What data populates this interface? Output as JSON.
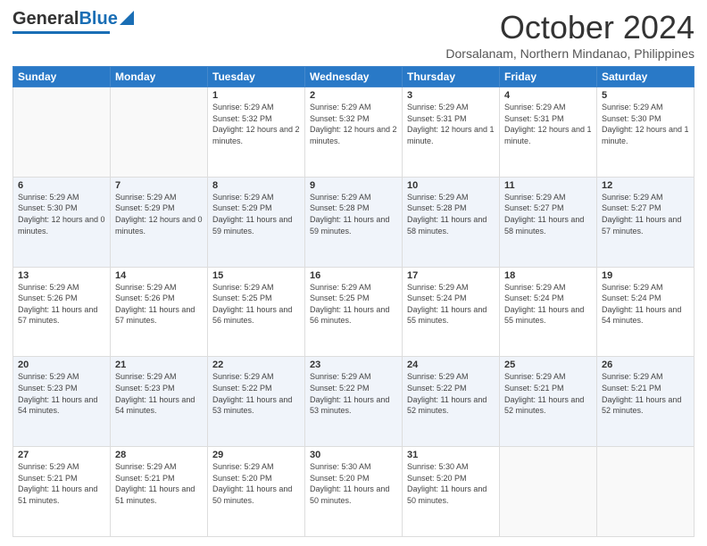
{
  "header": {
    "logo_text_general": "General",
    "logo_text_blue": "Blue",
    "month_title": "October 2024",
    "location": "Dorsalanam, Northern Mindanao, Philippines"
  },
  "days_of_week": [
    "Sunday",
    "Monday",
    "Tuesday",
    "Wednesday",
    "Thursday",
    "Friday",
    "Saturday"
  ],
  "weeks": [
    [
      {
        "day": "",
        "info": ""
      },
      {
        "day": "",
        "info": ""
      },
      {
        "day": "1",
        "info": "Sunrise: 5:29 AM\nSunset: 5:32 PM\nDaylight: 12 hours and 2 minutes."
      },
      {
        "day": "2",
        "info": "Sunrise: 5:29 AM\nSunset: 5:32 PM\nDaylight: 12 hours and 2 minutes."
      },
      {
        "day": "3",
        "info": "Sunrise: 5:29 AM\nSunset: 5:31 PM\nDaylight: 12 hours and 1 minute."
      },
      {
        "day": "4",
        "info": "Sunrise: 5:29 AM\nSunset: 5:31 PM\nDaylight: 12 hours and 1 minute."
      },
      {
        "day": "5",
        "info": "Sunrise: 5:29 AM\nSunset: 5:30 PM\nDaylight: 12 hours and 1 minute."
      }
    ],
    [
      {
        "day": "6",
        "info": "Sunrise: 5:29 AM\nSunset: 5:30 PM\nDaylight: 12 hours and 0 minutes."
      },
      {
        "day": "7",
        "info": "Sunrise: 5:29 AM\nSunset: 5:29 PM\nDaylight: 12 hours and 0 minutes."
      },
      {
        "day": "8",
        "info": "Sunrise: 5:29 AM\nSunset: 5:29 PM\nDaylight: 11 hours and 59 minutes."
      },
      {
        "day": "9",
        "info": "Sunrise: 5:29 AM\nSunset: 5:28 PM\nDaylight: 11 hours and 59 minutes."
      },
      {
        "day": "10",
        "info": "Sunrise: 5:29 AM\nSunset: 5:28 PM\nDaylight: 11 hours and 58 minutes."
      },
      {
        "day": "11",
        "info": "Sunrise: 5:29 AM\nSunset: 5:27 PM\nDaylight: 11 hours and 58 minutes."
      },
      {
        "day": "12",
        "info": "Sunrise: 5:29 AM\nSunset: 5:27 PM\nDaylight: 11 hours and 57 minutes."
      }
    ],
    [
      {
        "day": "13",
        "info": "Sunrise: 5:29 AM\nSunset: 5:26 PM\nDaylight: 11 hours and 57 minutes."
      },
      {
        "day": "14",
        "info": "Sunrise: 5:29 AM\nSunset: 5:26 PM\nDaylight: 11 hours and 57 minutes."
      },
      {
        "day": "15",
        "info": "Sunrise: 5:29 AM\nSunset: 5:25 PM\nDaylight: 11 hours and 56 minutes."
      },
      {
        "day": "16",
        "info": "Sunrise: 5:29 AM\nSunset: 5:25 PM\nDaylight: 11 hours and 56 minutes."
      },
      {
        "day": "17",
        "info": "Sunrise: 5:29 AM\nSunset: 5:24 PM\nDaylight: 11 hours and 55 minutes."
      },
      {
        "day": "18",
        "info": "Sunrise: 5:29 AM\nSunset: 5:24 PM\nDaylight: 11 hours and 55 minutes."
      },
      {
        "day": "19",
        "info": "Sunrise: 5:29 AM\nSunset: 5:24 PM\nDaylight: 11 hours and 54 minutes."
      }
    ],
    [
      {
        "day": "20",
        "info": "Sunrise: 5:29 AM\nSunset: 5:23 PM\nDaylight: 11 hours and 54 minutes."
      },
      {
        "day": "21",
        "info": "Sunrise: 5:29 AM\nSunset: 5:23 PM\nDaylight: 11 hours and 54 minutes."
      },
      {
        "day": "22",
        "info": "Sunrise: 5:29 AM\nSunset: 5:22 PM\nDaylight: 11 hours and 53 minutes."
      },
      {
        "day": "23",
        "info": "Sunrise: 5:29 AM\nSunset: 5:22 PM\nDaylight: 11 hours and 53 minutes."
      },
      {
        "day": "24",
        "info": "Sunrise: 5:29 AM\nSunset: 5:22 PM\nDaylight: 11 hours and 52 minutes."
      },
      {
        "day": "25",
        "info": "Sunrise: 5:29 AM\nSunset: 5:21 PM\nDaylight: 11 hours and 52 minutes."
      },
      {
        "day": "26",
        "info": "Sunrise: 5:29 AM\nSunset: 5:21 PM\nDaylight: 11 hours and 52 minutes."
      }
    ],
    [
      {
        "day": "27",
        "info": "Sunrise: 5:29 AM\nSunset: 5:21 PM\nDaylight: 11 hours and 51 minutes."
      },
      {
        "day": "28",
        "info": "Sunrise: 5:29 AM\nSunset: 5:21 PM\nDaylight: 11 hours and 51 minutes."
      },
      {
        "day": "29",
        "info": "Sunrise: 5:29 AM\nSunset: 5:20 PM\nDaylight: 11 hours and 50 minutes."
      },
      {
        "day": "30",
        "info": "Sunrise: 5:30 AM\nSunset: 5:20 PM\nDaylight: 11 hours and 50 minutes."
      },
      {
        "day": "31",
        "info": "Sunrise: 5:30 AM\nSunset: 5:20 PM\nDaylight: 11 hours and 50 minutes."
      },
      {
        "day": "",
        "info": ""
      },
      {
        "day": "",
        "info": ""
      }
    ]
  ]
}
